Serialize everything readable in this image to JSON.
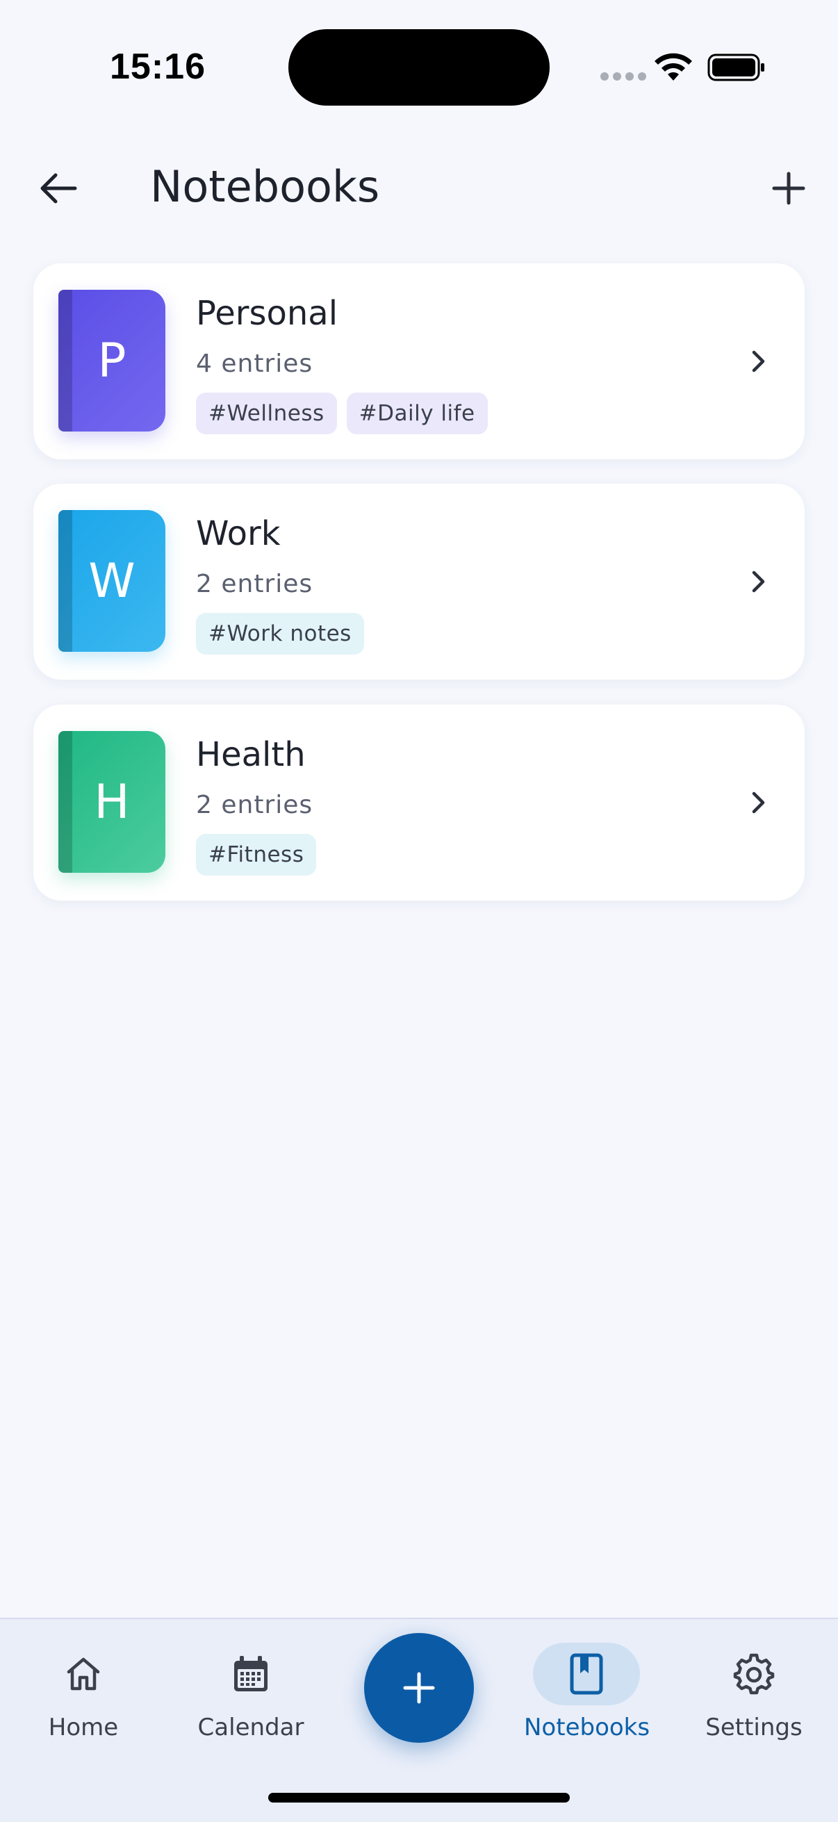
{
  "status_bar": {
    "time": "15:16"
  },
  "header": {
    "title": "Notebooks",
    "back_icon": "arrow-left-icon",
    "add_icon": "plus-icon"
  },
  "notebooks": [
    {
      "letter": "P",
      "name": "Personal",
      "count": "4 entries",
      "tags": [
        "#Wellness",
        "#Daily life"
      ],
      "color": "#5b4ee6"
    },
    {
      "letter": "W",
      "name": "Work",
      "count": "2 entries",
      "tags": [
        "#Work notes"
      ],
      "color": "#1ba6ea"
    },
    {
      "letter": "H",
      "name": "Health",
      "count": "2 entries",
      "tags": [
        "#Fitness"
      ],
      "color": "#1fb884"
    }
  ],
  "bottom_nav": {
    "items": [
      {
        "label": "Home",
        "icon": "home-icon"
      },
      {
        "label": "Calendar",
        "icon": "calendar-icon"
      },
      {
        "label": "Notebooks",
        "icon": "notebook-icon",
        "active": true
      },
      {
        "label": "Settings",
        "icon": "gear-icon"
      }
    ],
    "fab_icon": "plus-icon"
  },
  "colors": {
    "accent": "#0b5aa6",
    "active_nav_bg": "#cfe0f3",
    "background": "#f5f7fd"
  }
}
